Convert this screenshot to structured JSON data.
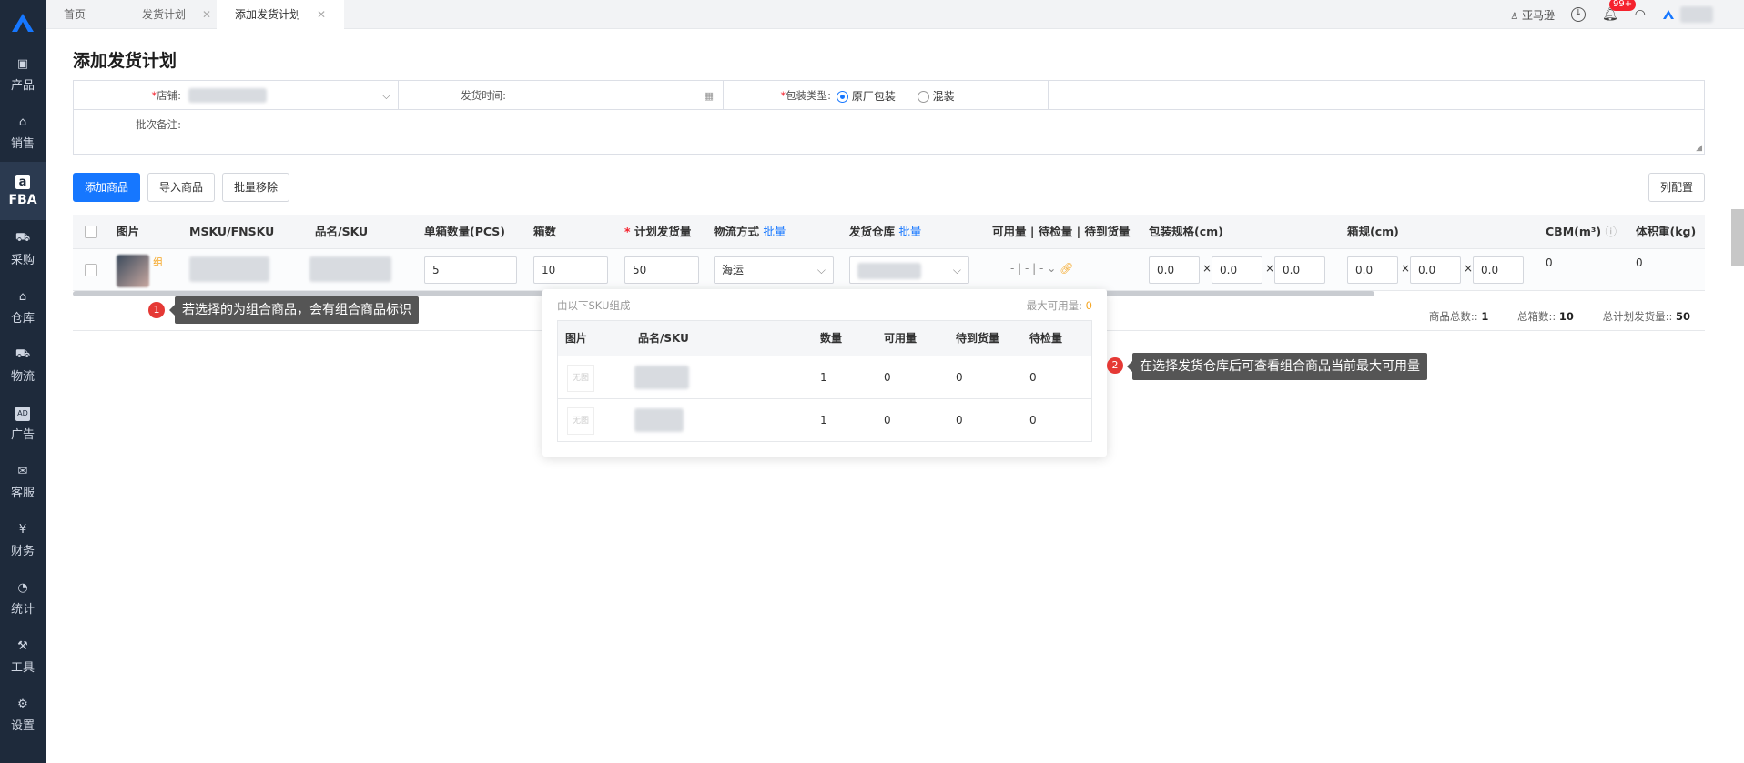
{
  "sidebar": {
    "items": [
      {
        "label": "产品",
        "icon": "bag-icon"
      },
      {
        "label": "销售",
        "icon": "store-icon"
      },
      {
        "label": "FBA",
        "icon": "amazon-icon",
        "active": true
      },
      {
        "label": "采购",
        "icon": "cart-icon"
      },
      {
        "label": "仓库",
        "icon": "warehouse-icon"
      },
      {
        "label": "物流",
        "icon": "truck-icon"
      },
      {
        "label": "广告",
        "icon": "ad-icon"
      },
      {
        "label": "客服",
        "icon": "mail-icon"
      },
      {
        "label": "财务",
        "icon": "yen-icon"
      },
      {
        "label": "统计",
        "icon": "pie-chart-icon"
      },
      {
        "label": "工具",
        "icon": "wrench-icon"
      },
      {
        "label": "设置",
        "icon": "gear-icon"
      }
    ]
  },
  "tabs": {
    "home": "首页",
    "plan": "发货计划",
    "add": "添加发货计划"
  },
  "topbar": {
    "platform": "亚马逊",
    "badge": "99+"
  },
  "page_title": "添加发货计划",
  "form": {
    "shop_label": "店铺:",
    "time_label": "发货时间:",
    "pack_label": "包装类型:",
    "pack_opt1": "原厂包装",
    "pack_opt2": "混装",
    "note_label": "批次备注:"
  },
  "buttons": {
    "add_product": "添加商品",
    "import_product": "导入商品",
    "batch_remove": "批量移除",
    "columns": "列配置"
  },
  "table": {
    "headers": {
      "image": "图片",
      "msku": "MSKU/FNSKU",
      "name_sku": "品名/SKU",
      "per_box": "单箱数量(PCS)",
      "boxes": "箱数",
      "plan_qty": "计划发货量",
      "shipping": "物流方式",
      "batch": "批量",
      "warehouse": "发货仓库",
      "avail": "可用量 | 待检量 | 待到货量",
      "pack_spec": "包装规格(cm)",
      "box_spec": "箱规(cm)",
      "cbm": "CBM(m³)",
      "vol_weight": "体积重(kg)"
    },
    "row": {
      "combo_mark": "组",
      "per_box": "5",
      "boxes": "10",
      "plan_qty": "50",
      "shipping": "海运",
      "avail_a": "-",
      "avail_b": "-",
      "avail_c": "-",
      "dim1": "0.0",
      "dim2": "0.0",
      "dim3": "0.0",
      "box1": "0.0",
      "box2": "0.0",
      "box3": "0.0",
      "cbm": "0",
      "vol": "0"
    },
    "summary": {
      "total_products_label": "商品总数::",
      "total_products": "1",
      "total_boxes_label": "总箱数::",
      "total_boxes": "10",
      "total_plan_label": "总计划发货量::",
      "total_plan": "50"
    }
  },
  "popover": {
    "title": "由以下SKU组成",
    "max_label": "最大可用量:",
    "max_value": "0",
    "headers": {
      "image": "图片",
      "name": "品名/SKU",
      "qty": "数量",
      "avail": "可用量",
      "incoming": "待到货量",
      "inspect": "待检量"
    },
    "rows": [
      {
        "noimg": "无图",
        "qty": "1",
        "avail": "0",
        "incoming": "0",
        "inspect": "0"
      },
      {
        "noimg": "无图",
        "qty": "1",
        "avail": "0",
        "incoming": "0",
        "inspect": "0"
      }
    ]
  },
  "tips": {
    "t1_num": "1",
    "t1": "若选择的为组合商品，会有组合商品标识",
    "t2_num": "2",
    "t2": "在选择发货仓库后可查看组合商品当前最大可用量"
  }
}
